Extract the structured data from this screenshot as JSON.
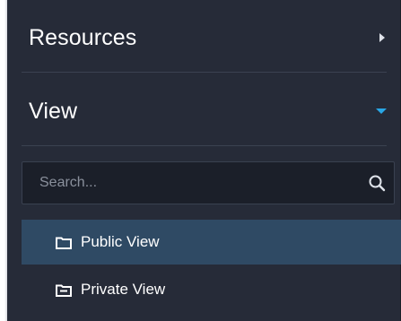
{
  "sections": {
    "resources": {
      "title": "Resources",
      "expanded": false
    },
    "view": {
      "title": "View",
      "expanded": true
    }
  },
  "search": {
    "placeholder": "Search...",
    "value": ""
  },
  "view_items": [
    {
      "label": "Public View",
      "icon": "folder-outline-icon",
      "selected": true
    },
    {
      "label": "Private View",
      "icon": "folder-private-icon",
      "selected": false
    }
  ],
  "colors": {
    "panel_bg": "#262b38",
    "selected_bg": "#2f4a64",
    "accent": "#29a7e6"
  }
}
